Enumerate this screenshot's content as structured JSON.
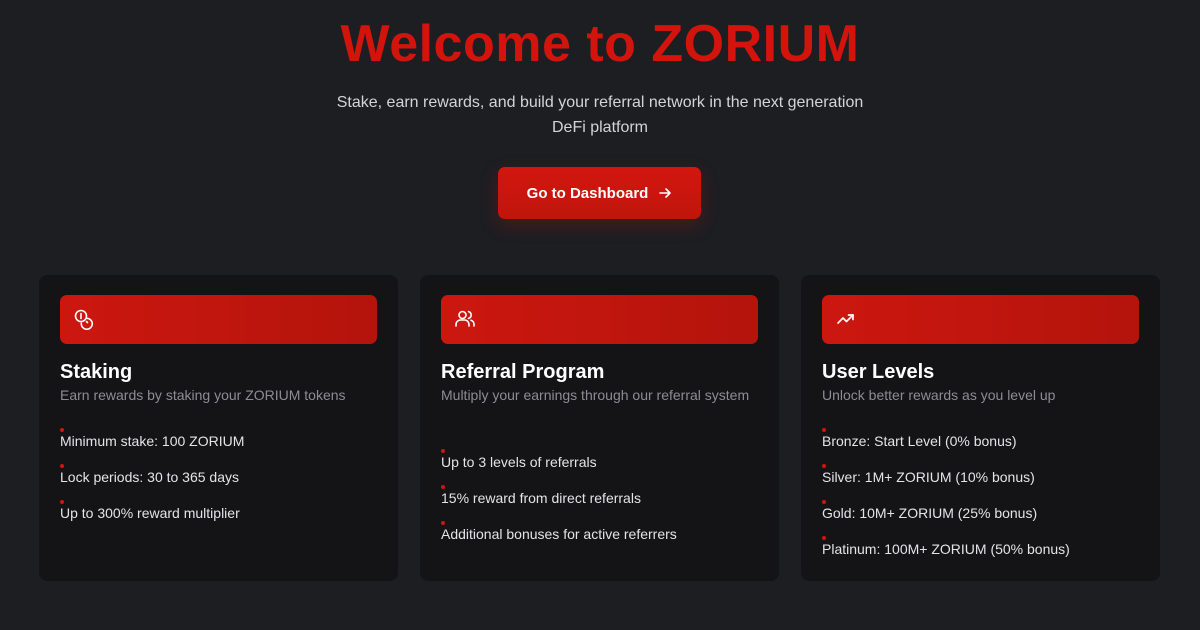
{
  "hero": {
    "title": "Welcome to ZORIUM",
    "subtitle": "Stake, earn rewards, and build your referral network in the next generation DeFi platform",
    "cta_label": "Go to Dashboard",
    "cta_icon": "arrow-right-icon"
  },
  "colors": {
    "accent": "#d2140d",
    "background": "#1d1e22",
    "card_background": "#141417",
    "muted_text": "#8c8c94"
  },
  "cards": [
    {
      "icon": "coins-icon",
      "title": "Staking",
      "description": "Earn rewards by staking your ZORIUM tokens",
      "items": [
        "Minimum stake: 100 ZORIUM",
        "Lock periods: 30 to 365 days",
        "Up to 300% reward multiplier"
      ]
    },
    {
      "icon": "users-icon",
      "title": "Referral Program",
      "description": "Multiply your earnings through our referral system",
      "items": [
        "Up to 3 levels of referrals",
        "15% reward from direct referrals",
        "Additional bonuses for active referrers"
      ]
    },
    {
      "icon": "trending-up-icon",
      "title": "User Levels",
      "description": "Unlock better rewards as you level up",
      "items": [
        "Bronze: Start Level (0% bonus)",
        "Silver: 1M+ ZORIUM (10% bonus)",
        "Gold: 10M+ ZORIUM (25% bonus)",
        "Platinum: 100M+ ZORIUM (50% bonus)"
      ]
    }
  ]
}
